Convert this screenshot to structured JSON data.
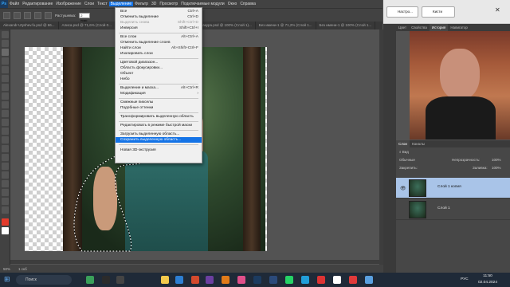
{
  "app": {
    "logo": "Ps"
  },
  "menubar": [
    "Файл",
    "Редактирование",
    "Изображение",
    "Слои",
    "Текст",
    "Выделение",
    "Фильтр",
    "3D",
    "Просмотр",
    "Подключаемые модули",
    "Окно",
    "Справка"
  ],
  "options": {
    "feather_label": "Растушевка:",
    "feather_value": "2 пикс"
  },
  "doc_tabs": [
    "Alexandr-Utyshev.fu.psd @ 66...",
    "Алиса.psd @ 71,6% (Слой 0...",
    "Без имени-1 @ 50% (Слой 1 копия, RGB/8) *",
    "Сакура.psd @ 100% (Слой 1)...",
    "Без имени-1 @ 71,2% (Слой 1...",
    "Без имени-1 @ 100% (Слой 1..."
  ],
  "dropdown": {
    "items": [
      {
        "label": "Все",
        "shortcut": "Ctrl+A",
        "disabled": false
      },
      {
        "label": "Отменить выделение",
        "shortcut": "Ctrl+D",
        "disabled": false
      },
      {
        "label": "Выделить снова",
        "shortcut": "Shift+Ctrl+D",
        "disabled": true
      },
      {
        "label": "Инверсия",
        "shortcut": "Shift+Ctrl+I",
        "disabled": false
      },
      {
        "label": "Все слои",
        "shortcut": "Alt+Ctrl+A",
        "disabled": false
      },
      {
        "label": "Отменить выделение слоев",
        "shortcut": "",
        "disabled": false
      },
      {
        "label": "Найти слои",
        "shortcut": "Alt+Shift+Ctrl+F",
        "disabled": false
      },
      {
        "label": "Изолировать слои",
        "shortcut": "",
        "disabled": false
      },
      {
        "label": "Цветовой диапазон...",
        "shortcut": "",
        "disabled": false
      },
      {
        "label": "Область фокусировки...",
        "shortcut": "",
        "disabled": false
      },
      {
        "label": "Объект",
        "shortcut": "",
        "disabled": false
      },
      {
        "label": "Небо",
        "shortcut": "",
        "disabled": false
      },
      {
        "label": "Выделение и маска...",
        "shortcut": "Alt+Ctrl+R",
        "disabled": false
      },
      {
        "label": "Модификация",
        "shortcut": "›",
        "disabled": false
      },
      {
        "label": "Смежные пикселы",
        "shortcut": "",
        "disabled": false
      },
      {
        "label": "Подобные оттенки",
        "shortcut": "",
        "disabled": false
      },
      {
        "label": "Трансформировать выделенную область",
        "shortcut": "",
        "disabled": false
      },
      {
        "label": "Редактировать в режиме быстрой маски",
        "shortcut": "",
        "disabled": false
      },
      {
        "label": "Загрузить выделенную область...",
        "shortcut": "",
        "disabled": false
      },
      {
        "label": "Сохранить выделенную область...",
        "shortcut": "",
        "disabled": false
      },
      {
        "label": "Новая 3D-экструзия",
        "shortcut": "",
        "disabled": false
      }
    ]
  },
  "topright": {
    "btn1": "Настро...",
    "btn2": "Кисти"
  },
  "panel_tabs": [
    "Цвет",
    "Свойства",
    "История",
    "Навигатор"
  ],
  "layers_panel": {
    "tabs": [
      "Слои",
      "Каналы"
    ],
    "search": "Вид",
    "blend": "Обычные",
    "opacity_label": "Непрозрачность:",
    "opacity_value": "100%",
    "lock_label": "Закрепить:",
    "fill_label": "Заливка:",
    "fill_value": "100%",
    "layers": [
      "Слой 1 копия",
      "Слой 1"
    ]
  },
  "status": {
    "zoom": "50%",
    "info": "1 скб"
  },
  "taskbar": {
    "search": "Поиск",
    "lang": "РУС",
    "time": "11:50",
    "date": "02.04.2024"
  }
}
